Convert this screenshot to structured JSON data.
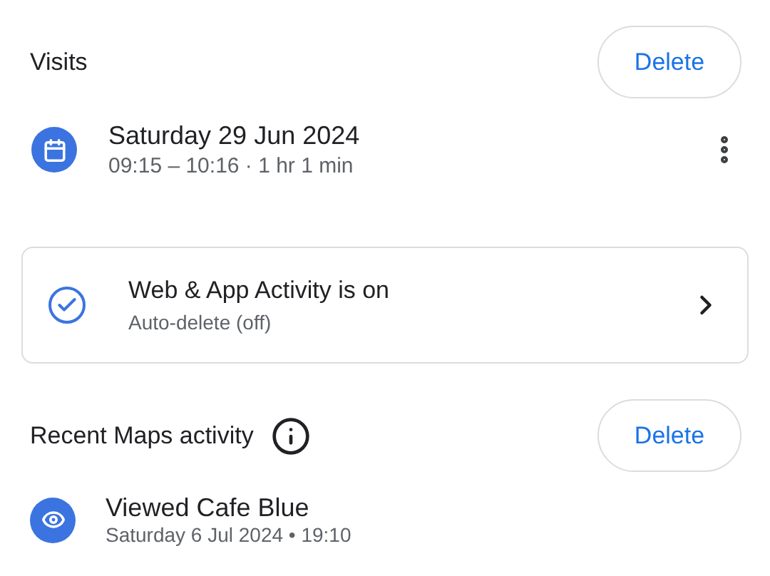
{
  "visits": {
    "title": "Visits",
    "delete_button": "Delete",
    "items": [
      {
        "kind": "calendar",
        "title": "Saturday 29 Jun 2024",
        "subtitle": "09:15 – 10:16 · 1 hr 1 min"
      }
    ]
  },
  "activity_card": {
    "title": "Web & App Activity is on",
    "subtitle": "Auto-delete (off)",
    "on": true
  },
  "recent": {
    "title": "Recent Maps activity",
    "delete_button": "Delete",
    "items": [
      {
        "kind": "viewed",
        "title": "Viewed Cafe Blue",
        "subtitle": "Saturday 6 Jul 2024 • 19:10"
      }
    ]
  }
}
